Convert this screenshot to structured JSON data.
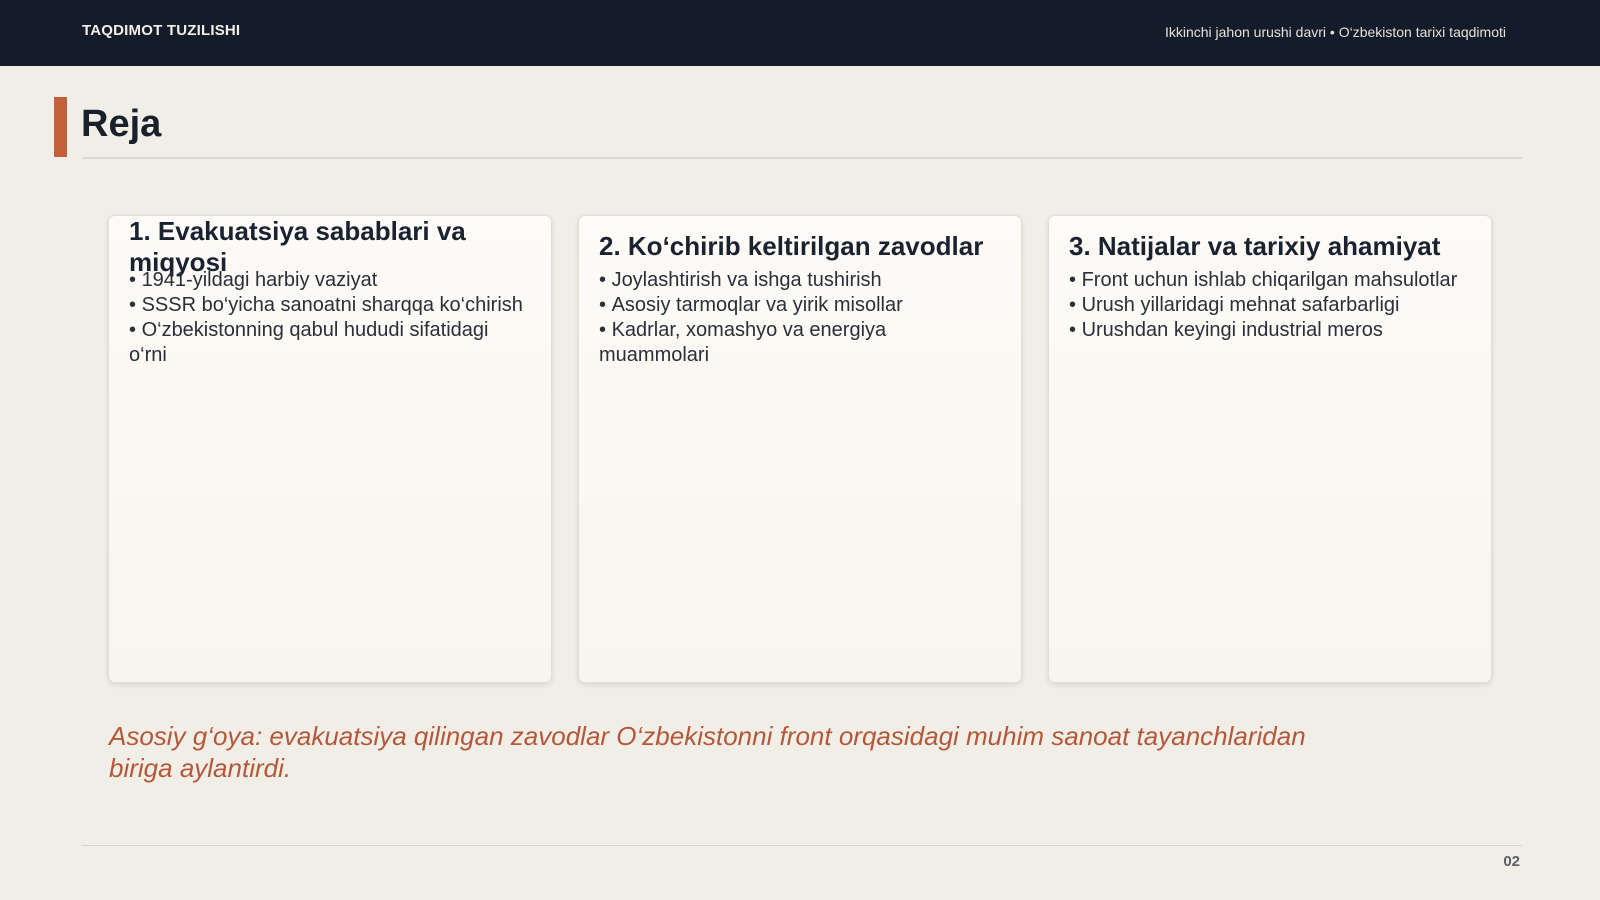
{
  "header": {
    "section_label": "TAQDIMOT TUZILISHI",
    "context": "Ikkinchi jahon urushi davri • O‘zbekiston tarixi taqdimoti"
  },
  "slide": {
    "title": "Reja",
    "accent_color": "#c45f3a",
    "page_number": "02"
  },
  "cards": [
    {
      "title": "1. Evakuatsiya sabablari va miqyosi",
      "items": [
        "1941-yildagi harbiy vaziyat",
        "SSSR bo‘yicha sanoatni sharqqa ko‘chirish",
        "O‘zbekistonning qabul hududi sifatidagi o‘rni"
      ]
    },
    {
      "title": "2. Ko‘chirib keltirilgan zavodlar",
      "items": [
        "Joylashtirish va ishga tushirish",
        "Asosiy tarmoqlar va yirik misollar",
        "Kadrlar, xomashyo va energiya muammolari"
      ]
    },
    {
      "title": "3. Natijalar va tarixiy ahamiyat",
      "items": [
        "Front uchun ishlab chiqarilgan mahsulotlar",
        "Urush yillaridagi mehnat safarbarligi",
        "Urushdan keyingi industrial meros"
      ]
    }
  ],
  "main_idea": "Asosiy g‘oya: evakuatsiya qilingan zavodlar O‘zbekistonni front orqasidagi muhim sanoat tayanchlaridan biriga aylantirdi."
}
